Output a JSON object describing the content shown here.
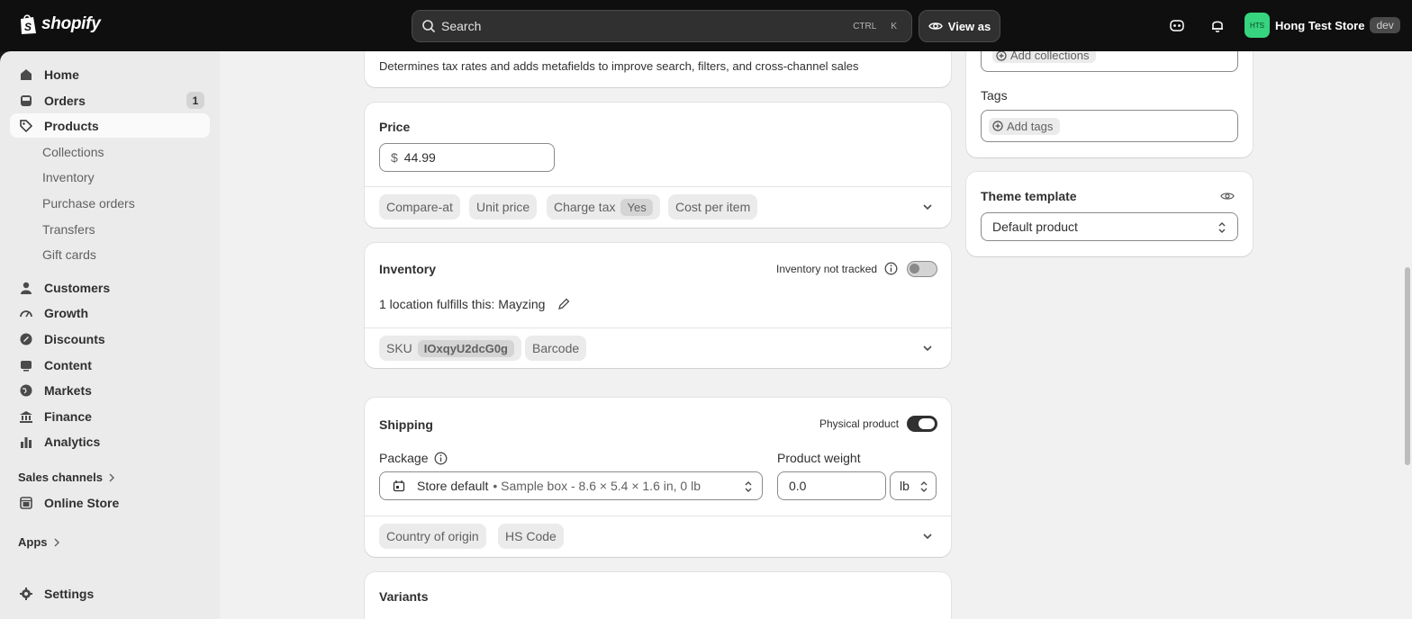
{
  "topbar": {
    "logo_text": "shopify",
    "search_label": "Search",
    "shortcut_ctrl": "CTRL",
    "shortcut_key": "K",
    "view_as_label": "View as",
    "store_initials": "HTS",
    "store_name": "Hong Test Store",
    "store_badge": "dev"
  },
  "sidebar": {
    "home": "Home",
    "orders": "Orders",
    "orders_count": "1",
    "products": "Products",
    "product_subitems": [
      "Collections",
      "Inventory",
      "Purchase orders",
      "Transfers",
      "Gift cards"
    ],
    "customers": "Customers",
    "growth": "Growth",
    "discounts": "Discounts",
    "content": "Content",
    "markets": "Markets",
    "finance": "Finance",
    "analytics": "Analytics",
    "sales_channels": "Sales channels",
    "online_store": "Online Store",
    "apps": "Apps",
    "settings": "Settings"
  },
  "category_card": {
    "help_text": "Determines tax rates and adds metafields to improve search, filters, and cross-channel sales"
  },
  "price_card": {
    "title": "Price",
    "currency": "$",
    "value": "44.99",
    "pills": {
      "compare_at": "Compare-at",
      "unit_price": "Unit price",
      "charge_tax": "Charge tax",
      "charge_tax_value": "Yes",
      "cost_per_item": "Cost per item"
    }
  },
  "inventory_card": {
    "title": "Inventory",
    "tracking_label": "Inventory not tracked",
    "tracked": false,
    "location_text": "1 location fulfills this: Mayzing",
    "sku_label": "SKU",
    "sku_value": "IOxqyU2dcG0g",
    "barcode_label": "Barcode"
  },
  "shipping_card": {
    "title": "Shipping",
    "physical_label": "Physical product",
    "physical": true,
    "package_label": "Package",
    "package_default": "Store default",
    "package_detail": "• Sample box - 8.6 × 5.4 × 1.6 in, 0 lb",
    "weight_label": "Product weight",
    "weight_value": "0.0",
    "weight_unit": "lb",
    "country_label": "Country of origin",
    "hs_code_label": "HS Code"
  },
  "variants_card": {
    "title": "Variants"
  },
  "organization_card": {
    "add_collections": "Add collections",
    "tags_label": "Tags",
    "add_tags": "Add tags"
  },
  "theme_card": {
    "title": "Theme template",
    "selected": "Default product"
  }
}
